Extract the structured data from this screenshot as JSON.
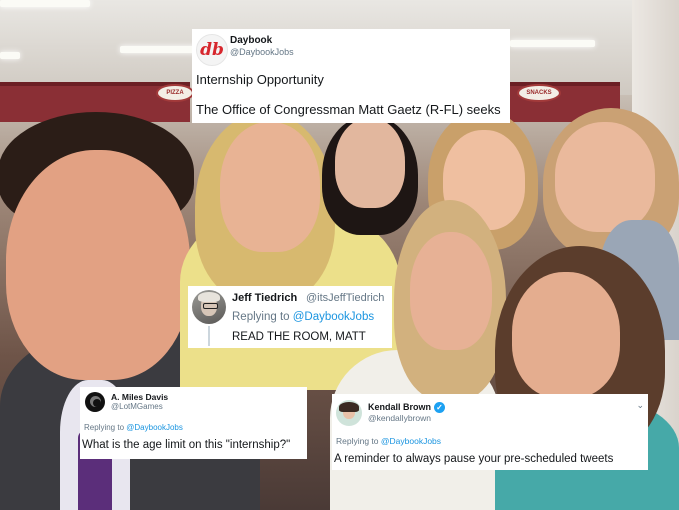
{
  "tweets": {
    "daybook": {
      "name": "Daybook",
      "handle": "@DaybookJobs",
      "avatar_text": "db",
      "line1": "Internship Opportunity",
      "line2": "The Office of Congressman Matt Gaetz (R-FL) seeks"
    },
    "jeff": {
      "name": "Jeff Tiedrich",
      "handle": "@itsJeffTiedrich",
      "reply_prefix": "Replying to",
      "reply_to": "@DaybookJobs",
      "text": "READ THE ROOM, MATT"
    },
    "miles": {
      "name": "A. Miles Davis",
      "handle": "@LotMGames",
      "reply_prefix": "Replying to",
      "reply_to": "@DaybookJobs",
      "text": "What is the age limit on this \"internship?\""
    },
    "kendall": {
      "name": "Kendall Brown",
      "handle": "@kendallybrown",
      "reply_prefix": "Replying to",
      "reply_to": "@DaybookJobs",
      "text": "A reminder to always pause your pre-scheduled tweets"
    }
  },
  "background": {
    "signs": [
      "PIZZA",
      "SNACKS"
    ]
  },
  "colors": {
    "link": "#1b95e0",
    "muted": "#657786",
    "verified": "#1da1f2",
    "daybook_brand": "#d7262d"
  }
}
